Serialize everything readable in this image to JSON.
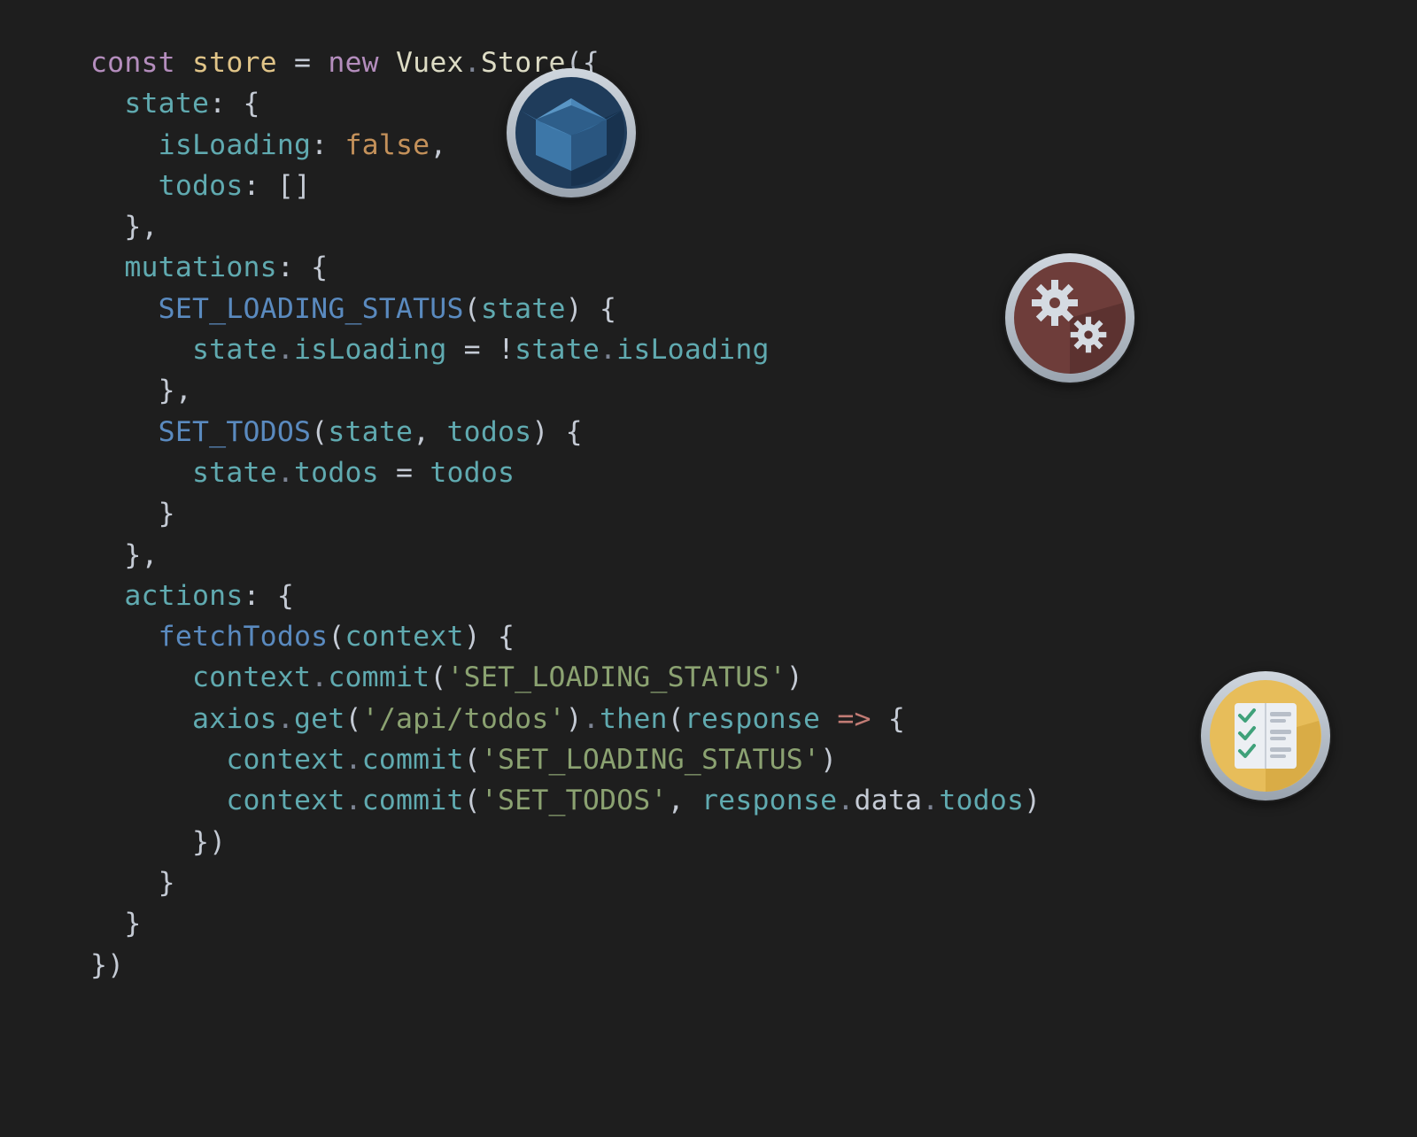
{
  "code": {
    "keywords": {
      "const": "const",
      "new": "new"
    },
    "identifiers": {
      "store": "store",
      "vuex": "Vuex",
      "Store": "Store",
      "state": "state",
      "isLoading": "isLoading",
      "todos": "todos",
      "mutations": "mutations",
      "actions": "actions",
      "context": "context",
      "commit": "commit",
      "axios": "axios",
      "get": "get",
      "then": "then",
      "response": "response",
      "data": "data",
      "fetchTodos": "fetchTodos",
      "SET_LOADING_STATUS": "SET_LOADING_STATUS",
      "SET_TODOS": "SET_TODOS"
    },
    "literals": {
      "false": "false",
      "emptyArray": "[]",
      "strSetLoading": "'SET_LOADING_STATUS'",
      "strSetTodos": "'SET_TODOS'",
      "strApi": "'/api/todos'"
    },
    "operators": {
      "eq": "=",
      "arrow": "=>",
      "bang": "!",
      "dot": ".",
      "comma": ",",
      "colon": ":",
      "open_paren": "(",
      "close_paren": ")",
      "open_brace": "{",
      "close_brace": "}",
      "open_call": "({",
      "close_call": "})"
    }
  },
  "badges": {
    "state": {
      "name": "state-badge",
      "icon": "box-icon",
      "ring": "#b9c2cc",
      "fill": "#1f3c5b"
    },
    "mutations": {
      "name": "mutations-badge",
      "icon": "gears-icon",
      "ring": "#b9c2cc",
      "fill": "#6e3d3a"
    },
    "actions": {
      "name": "actions-badge",
      "icon": "checklist-icon",
      "ring": "#b9c2cc",
      "fill": "#e7bd5a"
    }
  }
}
